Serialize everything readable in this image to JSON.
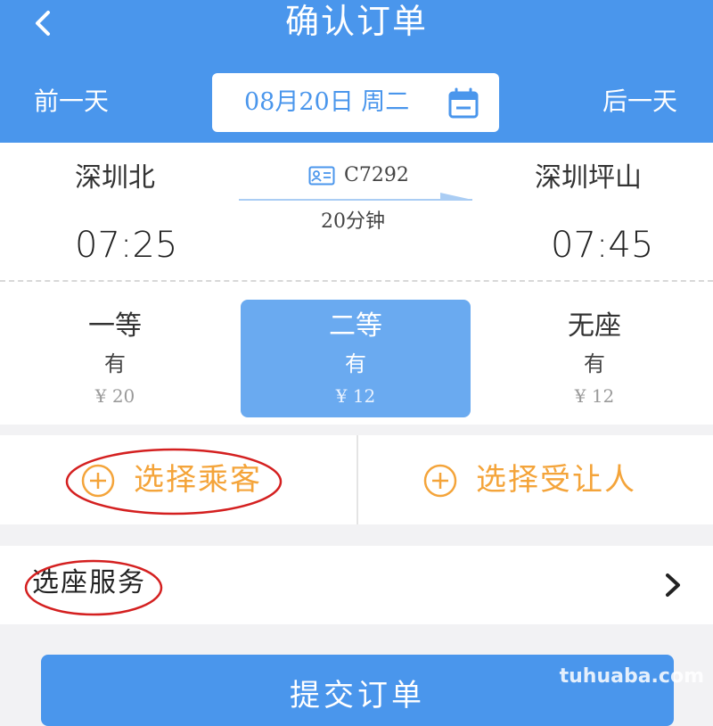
{
  "header": {
    "title": "确认订单",
    "prev_day": "前一天",
    "next_day": "后一天",
    "date": "08月20日  周二",
    "back_icon": "chevron-left-icon",
    "calendar_icon": "calendar-icon"
  },
  "train": {
    "from_station": "深圳北",
    "to_station": "深圳坪山",
    "depart_time": "07:25",
    "arrive_time": "07:45",
    "train_no": "C7292",
    "duration": "20分钟"
  },
  "seats": [
    {
      "name": "一等",
      "availability": "有",
      "price": "¥ 20",
      "selected": false
    },
    {
      "name": "二等",
      "availability": "有",
      "price": "¥ 12",
      "selected": true
    },
    {
      "name": "无座",
      "availability": "有",
      "price": "¥ 12",
      "selected": false
    }
  ],
  "passenger": {
    "choose_passenger": "选择乘客",
    "choose_transferee": "选择受让人"
  },
  "service": {
    "label": "选座服务"
  },
  "submit": {
    "label": "提交订单"
  },
  "watermark": "tuhuaba.com",
  "colors": {
    "primary": "#4a96ec",
    "selected_seat": "#6aaaf0",
    "accent_orange": "#f4a43a",
    "annotation_red": "#d42020"
  }
}
